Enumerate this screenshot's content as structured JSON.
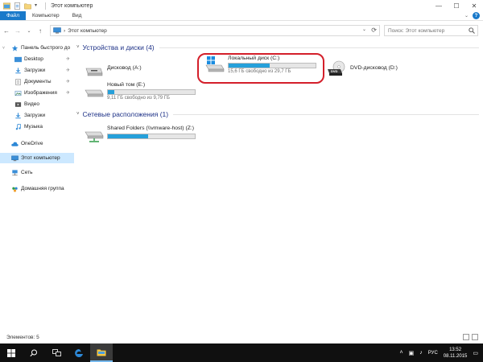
{
  "window": {
    "title": "Этот компьютер",
    "controls": {
      "minimize": "—",
      "maximize": "☐",
      "close": "✕"
    }
  },
  "ribbon": {
    "tabs": [
      "Файл",
      "Компьютер",
      "Вид"
    ],
    "expand_glyph": "⌄",
    "help_glyph": "?"
  },
  "navigation": {
    "back": "←",
    "forward": "→",
    "recent": "⌄",
    "up": "↑",
    "address_separator": "›",
    "address_path": "Этот компьютер",
    "address_dropdown": "⌄",
    "refresh": "⟳",
    "search_placeholder": "Поиск: Этот компьютер"
  },
  "sidebar": {
    "items": [
      {
        "label": "Панель быстрого до",
        "icon": "star-icon",
        "pinned": false
      },
      {
        "label": "Desktop",
        "icon": "desktop-icon",
        "pinned": true
      },
      {
        "label": "Загрузки",
        "icon": "downloads-icon",
        "pinned": true
      },
      {
        "label": "Документы",
        "icon": "documents-icon",
        "pinned": true
      },
      {
        "label": "Изображения",
        "icon": "pictures-icon",
        "pinned": true
      },
      {
        "label": "Видео",
        "icon": "video-icon",
        "pinned": false
      },
      {
        "label": "Загрузки",
        "icon": "downloads-icon",
        "pinned": false
      },
      {
        "label": "Музыка",
        "icon": "music-icon",
        "pinned": false
      },
      {
        "label": "OneDrive",
        "icon": "onedrive-icon",
        "pinned": false
      },
      {
        "label": "Этот компьютер",
        "icon": "computer-icon",
        "pinned": false
      },
      {
        "label": "Сеть",
        "icon": "network-icon",
        "pinned": false
      },
      {
        "label": "Домашняя группа",
        "icon": "homegroup-icon",
        "pinned": false
      }
    ],
    "pin_glyph": "✈"
  },
  "content": {
    "groups": [
      {
        "title": "Устройства и диски (4)"
      },
      {
        "title": "Сетевые расположения (1)"
      }
    ],
    "drives": [
      {
        "name": "Дисковод (A:)",
        "icon": "floppy-drive-icon",
        "has_bar": false,
        "free_text": "",
        "used_fraction": 0
      },
      {
        "name": "Локальный диск (C:)",
        "icon": "windows-drive-icon",
        "has_bar": true,
        "free_text": "15,6 ГБ свободно из 29,7 ГБ",
        "used_fraction": 0.47
      },
      {
        "name": "DVD-дисковод (D:)",
        "icon": "dvd-drive-icon",
        "has_bar": false,
        "free_text": "",
        "used_fraction": 0
      },
      {
        "name": "Новый том (E:)",
        "icon": "hard-drive-icon",
        "has_bar": true,
        "free_text": "9,11 ГБ свободно из 9,79 ГБ",
        "used_fraction": 0.07
      },
      {
        "name": "Shared Folders (\\\\vmware-host) (Z:)",
        "icon": "network-drive-icon",
        "has_bar": true,
        "free_text": "",
        "used_fraction": 0.46
      }
    ],
    "highlight_color": "#d41f2a"
  },
  "status": {
    "items_count": "Элементов: 5"
  },
  "taskbar": {
    "search_glyph": "⚲",
    "tray": {
      "language": "РУС",
      "time": "13:52",
      "date": "08.11.2015"
    }
  },
  "colors": {
    "accent": "#1979ca",
    "bar_fill": "#26a0da",
    "selection": "#cce8ff",
    "group_header": "#1e3287",
    "taskbar": "#101010"
  }
}
